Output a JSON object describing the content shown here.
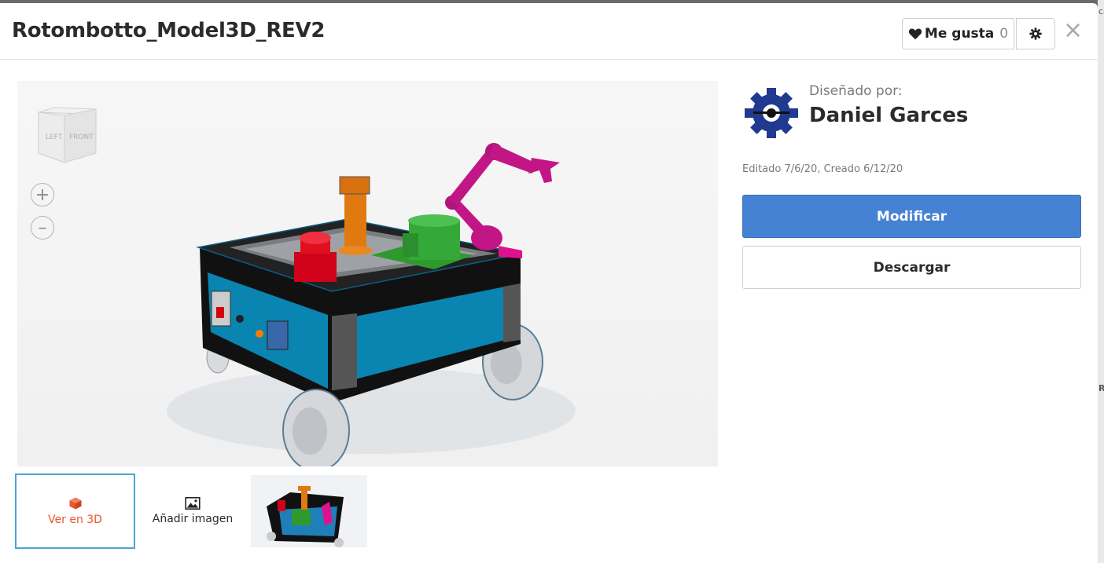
{
  "modal": {
    "title": "Rotombotto_Model3D_REV2",
    "like_label": "Me gusta",
    "like_count": "0",
    "settings_icon": "gear-icon",
    "close_glyph": "×"
  },
  "viewer": {
    "viewcube": {
      "left_label": "LEFT",
      "front_label": "FRONT"
    },
    "zoom_in_glyph": "+",
    "zoom_out_glyph": "–"
  },
  "thumbnails": {
    "view3d_label": "Ver en 3D",
    "add_image_label": "Añadir imagen"
  },
  "sidebar": {
    "designed_by_label": "Diseñado por:",
    "designer_name": "Daniel Garces",
    "dates": "Editado 7/6/20, Creado 6/12/20",
    "modify_label": "Modificar",
    "download_label": "Descargar"
  },
  "colors": {
    "accent_blue": "#4682d4",
    "active_thumb_border": "#4aa6d6",
    "view3d_orange": "#e8562a"
  }
}
